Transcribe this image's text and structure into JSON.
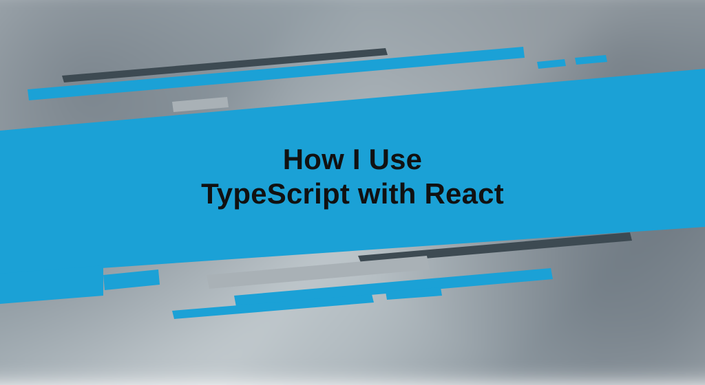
{
  "banner": {
    "title_line1": "How I Use",
    "title_line2": "TypeScript with React",
    "accent_color": "#1ba1d6",
    "accent_dark": "#3d4a52",
    "text_color": "#111111"
  }
}
